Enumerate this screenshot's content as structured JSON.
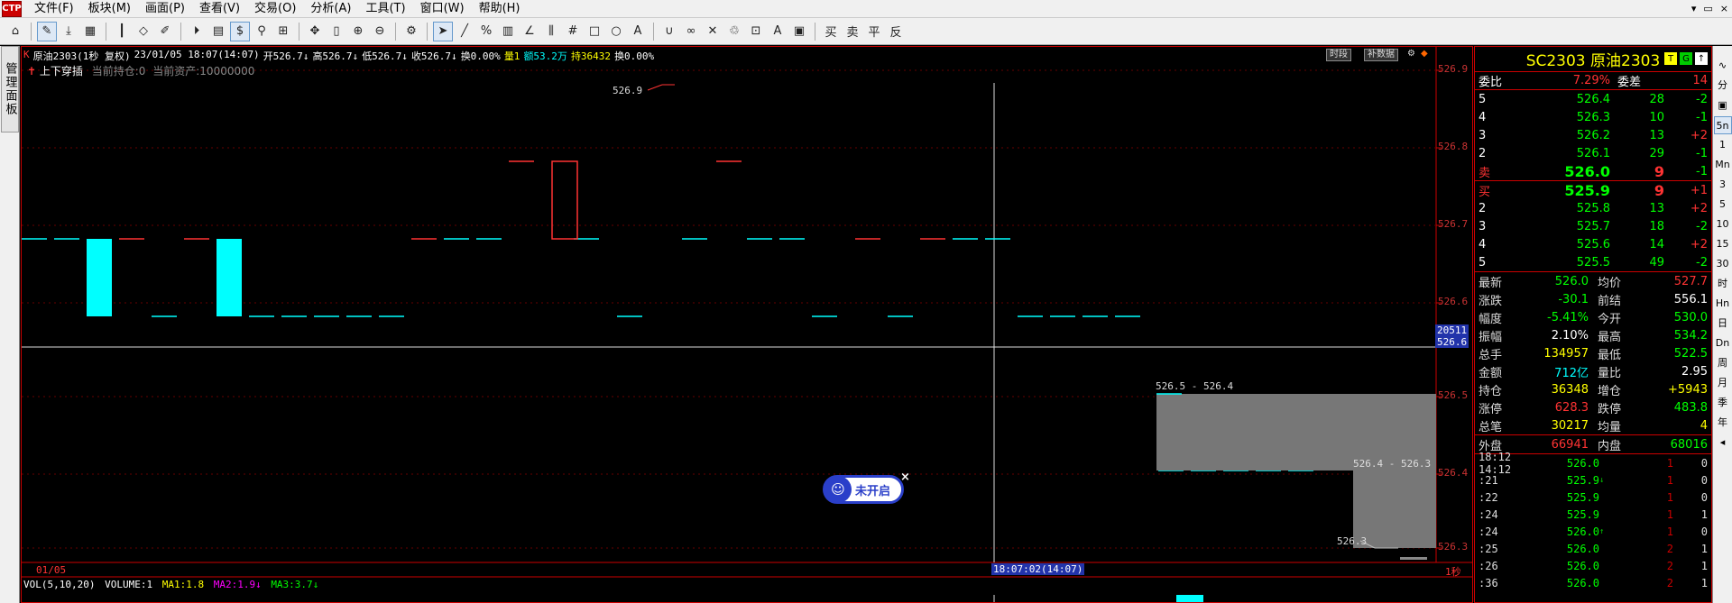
{
  "app": {
    "logo": "CTP",
    "menus": [
      "文件(F)",
      "板块(M)",
      "画面(P)",
      "查看(V)",
      "交易(O)",
      "分析(A)",
      "工具(T)",
      "窗口(W)",
      "帮助(H)"
    ],
    "window_controls": [
      "▾",
      "▭",
      "×"
    ]
  },
  "left_panel": {
    "tab_label": "管理面板"
  },
  "chart": {
    "info": {
      "symbol": "原油2303(1秒 复权)",
      "datetime": "23/01/05 18:07(14:07)",
      "open": "开526.7↓",
      "high": "高526.7↓",
      "low": "低526.7↓",
      "close": "收526.7↓",
      "change": "换0.00%",
      "volume": "量1",
      "amount": "额53.2万",
      "position": "持36432",
      "swap": "换0.00%"
    },
    "sub": {
      "indicator": "上下穿插",
      "holding": "当前持仓:0",
      "assets": "当前资产:10000000"
    },
    "buttons": {
      "period": "时段",
      "patch": "补数据"
    },
    "price_axis": [
      "526.9",
      "526.8",
      "526.7",
      "526.6",
      "526.5",
      "526.4",
      "526.3"
    ],
    "cursor_price": "526.6",
    "cursor_volume": "20511",
    "labels": {
      "high_mark": "526.9",
      "range1": "526.5 - 526.4",
      "range2": "526.4 - 526.3",
      "low_mark": "526.3"
    },
    "time_axis": {
      "date": "01/05",
      "cursor_time": "18:07:02(14:07)",
      "period": "1秒"
    },
    "volume_line": {
      "name": "VOL(5,10,20)",
      "volume": "VOLUME:1",
      "ma1": "MA1:1.8",
      "ma2": "MA2:1.9↓",
      "ma3": "MA3:3.7↓"
    },
    "not_open": {
      "label": "未开启",
      "close": "×"
    }
  },
  "quote": {
    "title": "SC2303 原油2303",
    "badges": [
      "T",
      "G",
      "↑"
    ],
    "weibi": {
      "label": "委比",
      "value": "7.29%",
      "label2": "委差",
      "value2": "14"
    },
    "asks": [
      {
        "level": "5",
        "price": "526.4",
        "vol": "28",
        "chg": "-2"
      },
      {
        "level": "4",
        "price": "526.3",
        "vol": "10",
        "chg": "-1"
      },
      {
        "level": "3",
        "price": "526.2",
        "vol": "13",
        "chg": "+2"
      },
      {
        "level": "2",
        "price": "526.1",
        "vol": "29",
        "chg": "-1"
      },
      {
        "level": "卖",
        "price": "526.0",
        "vol": "9",
        "chg": "-1"
      }
    ],
    "bids": [
      {
        "level": "买",
        "price": "525.9",
        "vol": "9",
        "chg": "+1"
      },
      {
        "level": "2",
        "price": "525.8",
        "vol": "13",
        "chg": "+2"
      },
      {
        "level": "3",
        "price": "525.7",
        "vol": "18",
        "chg": "-2"
      },
      {
        "level": "4",
        "price": "525.6",
        "vol": "14",
        "chg": "+2"
      },
      {
        "level": "5",
        "price": "525.5",
        "vol": "49",
        "chg": "-2"
      }
    ],
    "stats": [
      {
        "l1": "最新",
        "v1": "526.0",
        "c1": "green",
        "l2": "均价",
        "v2": "527.7",
        "c2": "red"
      },
      {
        "l1": "涨跌",
        "v1": "-30.1",
        "c1": "green",
        "l2": "前结",
        "v2": "556.1",
        "c2": "white"
      },
      {
        "l1": "幅度",
        "v1": "-5.41%",
        "c1": "green",
        "l2": "今开",
        "v2": "530.0",
        "c2": "green"
      },
      {
        "l1": "振幅",
        "v1": "2.10%",
        "c1": "white",
        "l2": "最高",
        "v2": "534.2",
        "c2": "green"
      },
      {
        "l1": "总手",
        "v1": "134957",
        "c1": "yellow",
        "l2": "最低",
        "v2": "522.5",
        "c2": "green"
      },
      {
        "l1": "金额",
        "v1": "712亿",
        "c1": "cyan",
        "l2": "量比",
        "v2": "2.95",
        "c2": "white"
      },
      {
        "l1": "持仓",
        "v1": "36348",
        "c1": "yellow",
        "l2": "增仓",
        "v2": "+5943",
        "c2": "yellow"
      },
      {
        "l1": "涨停",
        "v1": "628.3",
        "c1": "red",
        "l2": "跌停",
        "v2": "483.8",
        "c2": "green"
      },
      {
        "l1": "总笔",
        "v1": "30217",
        "c1": "yellow",
        "l2": "均量",
        "v2": "4",
        "c2": "yellow"
      }
    ],
    "outer": {
      "label": "外盘",
      "value": "66941",
      "label2": "内盘",
      "value2": "68016"
    },
    "ticks": [
      {
        "time": "18:12 14:12",
        "price": "526.0",
        "arrow": "",
        "vol": "1",
        "flag": "0"
      },
      {
        "time": ":21",
        "price": "525.9",
        "arrow": "↓",
        "vol": "1",
        "flag": "0"
      },
      {
        "time": ":22",
        "price": "525.9",
        "arrow": "",
        "vol": "1",
        "flag": "0"
      },
      {
        "time": ":24",
        "price": "525.9",
        "arrow": "",
        "vol": "1",
        "flag": "1"
      },
      {
        "time": ":24",
        "price": "526.0",
        "arrow": "↑",
        "vol": "1",
        "flag": "0"
      },
      {
        "time": ":25",
        "price": "526.0",
        "arrow": "",
        "vol": "2",
        "flag": "1"
      },
      {
        "time": ":26",
        "price": "526.0",
        "arrow": "",
        "vol": "2",
        "flag": "1"
      },
      {
        "time": ":36",
        "price": "526.0",
        "arrow": "",
        "vol": "2",
        "flag": "1"
      }
    ]
  },
  "right_strip": [
    "∿",
    "分",
    "▣",
    "5n",
    "1",
    "Mn",
    "3",
    "5",
    "10",
    "15",
    "30",
    "时",
    "Hn",
    "日",
    "Dn",
    "周",
    "月",
    "季",
    "年",
    "◂"
  ],
  "colors": {
    "red": "#ff3333",
    "green": "#00ff00",
    "cyan": "#00ffff",
    "yellow": "#ffff00",
    "axis": "#c00000"
  }
}
